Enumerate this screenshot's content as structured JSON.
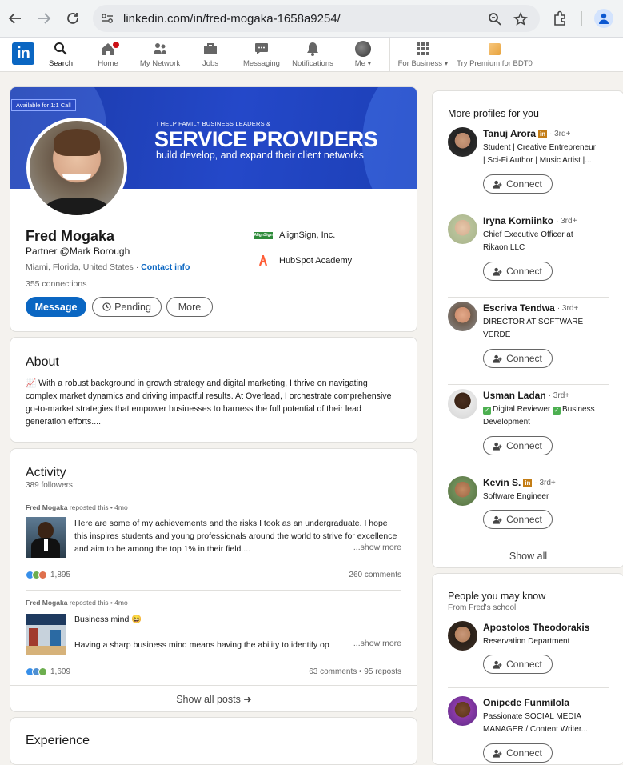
{
  "browser": {
    "url": "linkedin.com/in/fred-mogaka-1658a9254/"
  },
  "nav": {
    "items": [
      {
        "label": "Search",
        "icon": "search-icon"
      },
      {
        "label": "Home",
        "icon": "home-icon"
      },
      {
        "label": "My Network",
        "icon": "network-icon"
      },
      {
        "label": "Jobs",
        "icon": "briefcase-icon"
      },
      {
        "label": "Messaging",
        "icon": "messaging-icon"
      },
      {
        "label": "Notifications",
        "icon": "bell-icon"
      },
      {
        "label": "Me",
        "icon": "avatar-icon"
      },
      {
        "label": "For Business",
        "icon": "grid-icon"
      },
      {
        "label": "Try Premium for BDT0",
        "icon": "premium-icon"
      }
    ],
    "brand_color": "#0a66c2"
  },
  "profile": {
    "banner": {
      "badge": "Available for 1:1 Call",
      "small": "I HELP FAMILY BUSINESS LEADERS &",
      "big": "SERVICE PROVIDERS",
      "sub": "build develop, and expand their client networks"
    },
    "name": "Fred Mogaka",
    "headline": "Partner @Mark Borough",
    "location": "Miami, Florida, United States",
    "location_sep": " · ",
    "contact_info": "Contact info",
    "connections": "355 connections",
    "buttons": {
      "message": "Message",
      "pending": "Pending",
      "more": "More"
    },
    "experience_items": [
      {
        "name": "AlignSign, Inc.",
        "logo_text": "AlignSign"
      },
      {
        "name": "HubSpot Academy"
      }
    ]
  },
  "about": {
    "title": "About",
    "text": "📈 With a robust background in growth strategy and digital marketing, I thrive on navigating complex market dynamics and driving impactful results. At Overlead, I orchestrate comprehensive go-to-market strategies that empower businesses to harness the full potential of their lead generation efforts...."
  },
  "activity": {
    "title": "Activity",
    "followers": "389 followers",
    "posts": [
      {
        "author": "Fred Mogaka",
        "meta": "reposted this • 4mo",
        "text": "Here are some of my achievements and the risks I took as an undergraduate. I hope this inspires students and young professionals around the world to strive for excellence and aim to be among the top 1% in their field....",
        "show_more": "...show more",
        "reactions": "1,895",
        "comments": "260 comments"
      },
      {
        "author": "Fred Mogaka",
        "meta": "reposted this • 4mo",
        "text_line1": "Business mind 😄",
        "text_line2": "Having a sharp business mind means having the ability to identify op",
        "show_more": "...show more",
        "reactions": "1,609",
        "comments": "63 comments • 95 reposts"
      }
    ],
    "show_all": "Show all posts ➜"
  },
  "experience": {
    "title": "Experience"
  },
  "more_profiles": {
    "title": "More profiles for you",
    "people": [
      {
        "name": "Tanuj Arora",
        "degree": "· 3rd+",
        "headline_l1": "Student | Creative Entrepreneur",
        "headline_l2": "| Sci-Fi Author | Music Artist |...",
        "connect": "Connect"
      },
      {
        "name": "Iryna Korniinko",
        "degree": "· 3rd+",
        "headline_l1": "Chief Executive Officer at",
        "headline_l2": "Rikaon LLC",
        "connect": "Connect"
      },
      {
        "name": "Escriva Tendwa",
        "degree": "· 3rd+",
        "headline_l1": "DIRECTOR AT SOFTWARE",
        "headline_l2": "VERDE",
        "connect": "Connect"
      },
      {
        "name": "Usman Ladan",
        "degree": "· 3rd+",
        "headline_l1": "Digital Reviewer",
        "headline_l1b": "Business",
        "headline_l2": "Development",
        "connect": "Connect"
      },
      {
        "name": "Kevin S.",
        "degree": "· 3rd+",
        "headline_l1": "Software Engineer",
        "connect": "Connect"
      }
    ],
    "show_all": "Show all"
  },
  "people_know": {
    "title": "People you may know",
    "subtitle": "From Fred's school",
    "people": [
      {
        "name": "Apostolos Theodorakis",
        "headline_l1": "Reservation Department",
        "connect": "Connect"
      },
      {
        "name": "Onipede Funmilola",
        "headline_l1": "Passionate SOCIAL MEDIA",
        "headline_l2": "MANAGER / Content Writer...",
        "connect": "Connect"
      }
    ]
  }
}
